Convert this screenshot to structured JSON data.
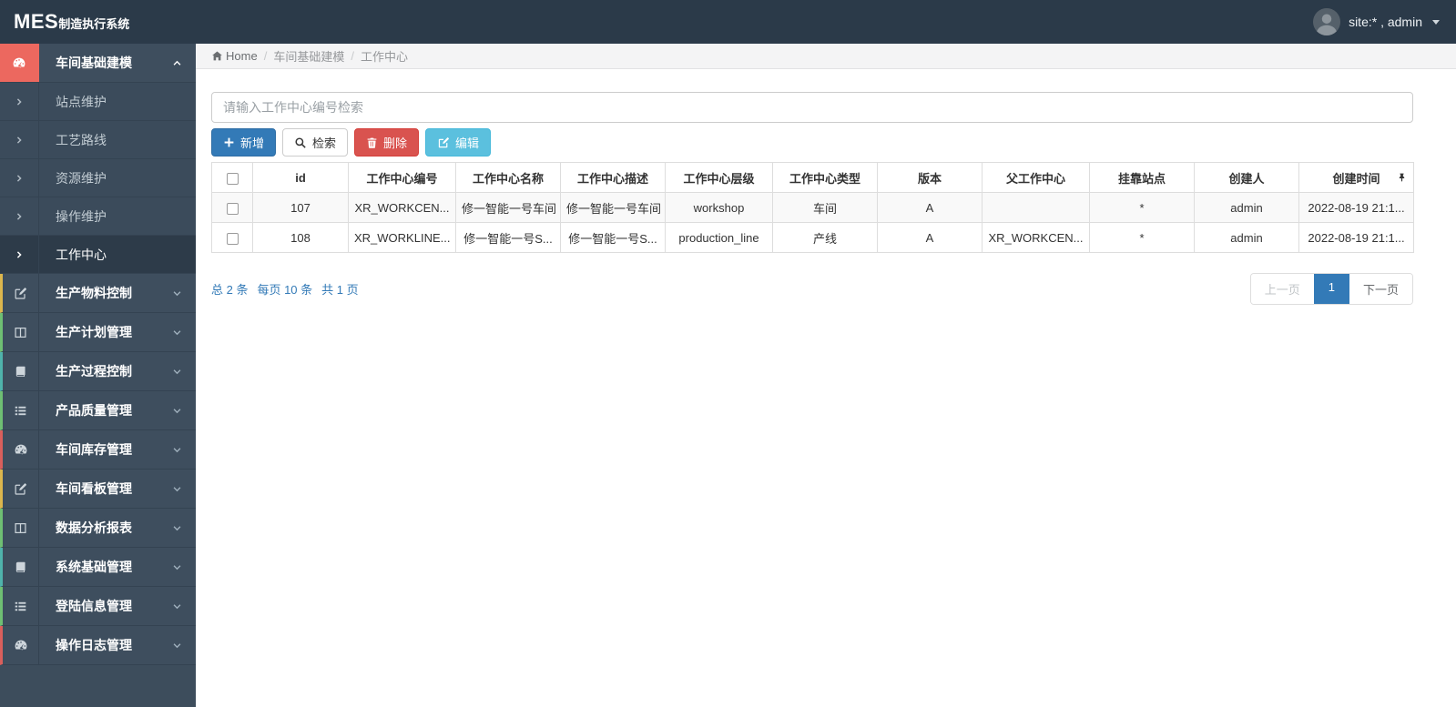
{
  "navbar": {
    "logo_mes": "MES",
    "logo_suffix": "制造执行系统",
    "user_label": "site:* , admin"
  },
  "breadcrumb": {
    "home": "Home",
    "section": "车间基础建模",
    "current": "工作中心",
    "separator": "/"
  },
  "search": {
    "placeholder": "请输入工作中心编号检索"
  },
  "toolbar": {
    "add": "新增",
    "search": "检索",
    "delete": "删除",
    "edit": "编辑"
  },
  "sidebar": {
    "parent": {
      "label": "车间基础建模"
    },
    "sub_items": [
      {
        "label": "站点维护"
      },
      {
        "label": "工艺路线"
      },
      {
        "label": "资源维护"
      },
      {
        "label": "操作维护"
      },
      {
        "label": "工作中心"
      }
    ],
    "items": [
      {
        "label": "生产物料控制",
        "icon": "pencil-icon",
        "border_color": "#dcb64d"
      },
      {
        "label": "生产计划管理",
        "icon": "columns-icon",
        "border_color": "#6fbf73"
      },
      {
        "label": "生产过程控制",
        "icon": "book-icon",
        "border_color": "#4fb3ab"
      },
      {
        "label": "产品质量管理",
        "icon": "list-icon",
        "border_color": "#6fbf73"
      },
      {
        "label": "车间库存管理",
        "icon": "tachometer-icon",
        "border_color": "#d95f5c"
      },
      {
        "label": "车间看板管理",
        "icon": "pencil-icon",
        "border_color": "#dcb64d"
      },
      {
        "label": "数据分析报表",
        "icon": "columns-icon",
        "border_color": "#6fbf73"
      },
      {
        "label": "系统基础管理",
        "icon": "book-icon",
        "border_color": "#4fb3ab"
      },
      {
        "label": "登陆信息管理",
        "icon": "list-icon",
        "border_color": "#6fbf73"
      },
      {
        "label": "操作日志管理",
        "icon": "tachometer-icon",
        "border_color": "#d95f5c"
      }
    ]
  },
  "table": {
    "headers": [
      "id",
      "工作中心编号",
      "工作中心名称",
      "工作中心描述",
      "工作中心层级",
      "工作中心类型",
      "版本",
      "父工作中心",
      "挂靠站点",
      "创建人",
      "创建时间"
    ],
    "rows": [
      {
        "id": "107",
        "code": "XR_WORKCEN...",
        "name": "修一智能一号车间",
        "desc": "修一智能一号车间",
        "level": "workshop",
        "type": "车间",
        "version": "A",
        "parent": "",
        "station": "*",
        "creator": "admin",
        "created": "2022-08-19 21:1..."
      },
      {
        "id": "108",
        "code": "XR_WORKLINE...",
        "name": "修一智能一号S...",
        "desc": "修一智能一号S...",
        "level": "production_line",
        "type": "产线",
        "version": "A",
        "parent": "XR_WORKCEN...",
        "station": "*",
        "creator": "admin",
        "created": "2022-08-19 21:1..."
      }
    ]
  },
  "pagination": {
    "summary_total": "总 2 条",
    "summary_per": "每页 10 条",
    "summary_pages": "共 1 页",
    "prev": "上一页",
    "page": "1",
    "next": "下一页"
  },
  "colors": {
    "primary": "#337ab7",
    "danger": "#d9534f",
    "info": "#5bc0de",
    "navbar_bg": "#2b3a49",
    "sidebar_bg": "#3d4d5c",
    "sidebar_active_icon_bg": "#ec685f",
    "link_blue": "#337ab7"
  }
}
